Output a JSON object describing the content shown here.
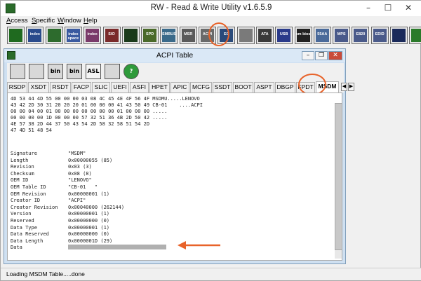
{
  "window": {
    "title": "RW - Read & Write Utility v1.6.5.9"
  },
  "menu": [
    {
      "key": "A",
      "rest": "ccess"
    },
    {
      "key": "S",
      "rest": "pecific"
    },
    {
      "key": "W",
      "rest": "indow"
    },
    {
      "key": "H",
      "rest": "elp"
    }
  ],
  "toolbar": [
    {
      "name": "pci-icon",
      "text": "",
      "color": "#1f6a1f"
    },
    {
      "name": "index-icon",
      "text": "index",
      "color": "#2a4b8c"
    },
    {
      "name": "memory-icon",
      "text": "",
      "color": "#2d6b2d"
    },
    {
      "name": "index-space-icon",
      "text": "index space",
      "color": "#3a5aa0"
    },
    {
      "name": "index-mem-icon",
      "text": "index",
      "color": "#7a3a6a"
    },
    {
      "name": "sio-icon",
      "text": "SIO",
      "color": "#7a2a2a"
    },
    {
      "name": "waveform-icon",
      "text": "",
      "color": "#1a3a1a"
    },
    {
      "name": "spd-icon",
      "text": "SPD",
      "color": "#4a6a2a"
    },
    {
      "name": "smbus-icon",
      "text": "SMBUS",
      "color": "#3a6a8a"
    },
    {
      "name": "msr-icon",
      "text": "MSR",
      "color": "#5a5a5a"
    },
    {
      "name": "acpi-icon",
      "text": "ACPI",
      "color": "#6a6a6a"
    },
    {
      "name": "ec-icon",
      "text": "EC",
      "color": "#2a4a7a"
    },
    {
      "name": "cmos-icon",
      "text": "",
      "color": "#7a7a7a"
    },
    {
      "name": "ata-icon",
      "text": "ATA",
      "color": "#3a3a3a"
    },
    {
      "name": "usb-icon",
      "text": "USB",
      "color": "#2a3a8a"
    },
    {
      "name": "smbios-icon",
      "text": "sm bios",
      "color": "#222222"
    },
    {
      "name": "55aa-icon",
      "text": "55AA",
      "color": "#4a6a9a"
    },
    {
      "name": "mps-icon",
      "text": "MPS",
      "color": "#4a5a8a"
    },
    {
      "name": "e820-icon",
      "text": "E820",
      "color": "#4a5a8a"
    },
    {
      "name": "edid-icon",
      "text": "EDID",
      "color": "#4a5a8a"
    },
    {
      "name": "command-icon",
      "text": "",
      "color": "#1a2a5a"
    },
    {
      "name": "chip-icon",
      "text": "",
      "color": "#2a7a2a"
    }
  ],
  "acpi": {
    "title": "ACPI Table",
    "tool_buttons": [
      "save-icon",
      "save-all-icon",
      "bin-icon",
      "bin-all-icon",
      "asl-icon",
      "binoculars-icon",
      "help-icon"
    ],
    "tool_labels": [
      "",
      "",
      "bin",
      "bin",
      "ASL",
      "",
      "?"
    ],
    "tabs": [
      "RSDP",
      "XSDT",
      "RSDT",
      "FACP",
      "SLIC",
      "UEFI",
      "ASFI",
      "HPET",
      "APIC",
      "MCFG",
      "SSDT",
      "BOOT",
      "ASPT",
      "DBGP",
      "FPDT",
      "MSDM"
    ],
    "active_tab": "MSDM",
    "hex_lines": [
      "4D 53 44 4D 55 00 00 00 03 08 4C 45 4E 4F 56 4F MSDMU.....LENOVO",
      "43 42 2D 30 31 20 20 20 01 00 00 00 41 43 50 49 CB-01    ....ACPI",
      "00 00 04 00 01 00 00 00 00 00 00 00 01 00 00 00 ................",
      "00 00 00 00 1D 00 00 00 57 32 51 36 4B 2D 50 42 ........",
      "4E 57 38 2D 44 37 50 43 54 2D 58 32 58 51 54 2D",
      "47 4D 51 48 54"
    ],
    "fields": [
      {
        "label": "Signature",
        "value": "\"MSDM\""
      },
      {
        "label": "Length",
        "value": "0x00000055 (85)"
      },
      {
        "label": "Revision",
        "value": "0x03 (3)"
      },
      {
        "label": "Checksum",
        "value": "0x08 (8)"
      },
      {
        "label": "OEM ID",
        "value": "\"LENOVO\""
      },
      {
        "label": "OEM Table ID",
        "value": "\"CB-01   \""
      },
      {
        "label": "OEM Revision",
        "value": "0x00000001 (1)"
      },
      {
        "label": "Creator ID",
        "value": "\"ACPI\""
      },
      {
        "label": "Creator Revision",
        "value": "0x00040000 (262144)"
      },
      {
        "label": "Version",
        "value": "0x00000001 (1)"
      },
      {
        "label": "Reserved",
        "value": "0x00000000 (0)"
      },
      {
        "label": "Data Type",
        "value": "0x00000001 (1)"
      },
      {
        "label": "Data Reserved",
        "value": "0x00000000 (0)"
      },
      {
        "label": "Data Length",
        "value": "0x0000001D (29)"
      },
      {
        "label": "Data",
        "value": ""
      }
    ]
  },
  "status": "Loading MSDM Table.....done",
  "colors": {
    "annotation": "#e8632a"
  }
}
